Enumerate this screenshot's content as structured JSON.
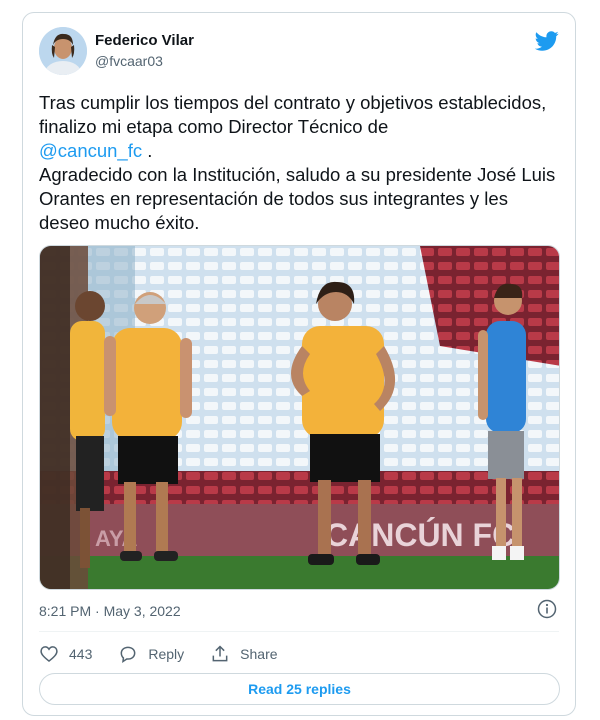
{
  "author": {
    "name": "Federico Vilar",
    "handle": "@fvcaar03"
  },
  "tweet": {
    "text_before_mention": "Tras cumplir los tiempos del contrato y objetivos establecidos, finalizo mi etapa como Director Técnico de",
    "mention": "@cancun_fc",
    "text_after_mention": " .",
    "paragraph_2": "Agradecido con la Institución, saludo a su presidente José Luis Orantes en representación de todos sus integrantes y les deseo mucho éxito.",
    "timestamp": "8:21 PM · May 3, 2022"
  },
  "media": {
    "banner_text": "CANCÚN FC",
    "banner_text_left": "AYA"
  },
  "actions": {
    "like_count": "443",
    "reply_label": "Reply",
    "share_label": "Share"
  },
  "read_replies_label": "Read 25 replies",
  "icons": {
    "brand": "twitter-bird-icon",
    "info": "info-icon",
    "like": "heart-icon",
    "reply": "speech-bubble-icon",
    "share": "share-upload-icon"
  },
  "colors": {
    "accent": "#1d9bf0",
    "text": "#0f1419",
    "secondary_text": "#536471",
    "border": "#cfd9de"
  }
}
